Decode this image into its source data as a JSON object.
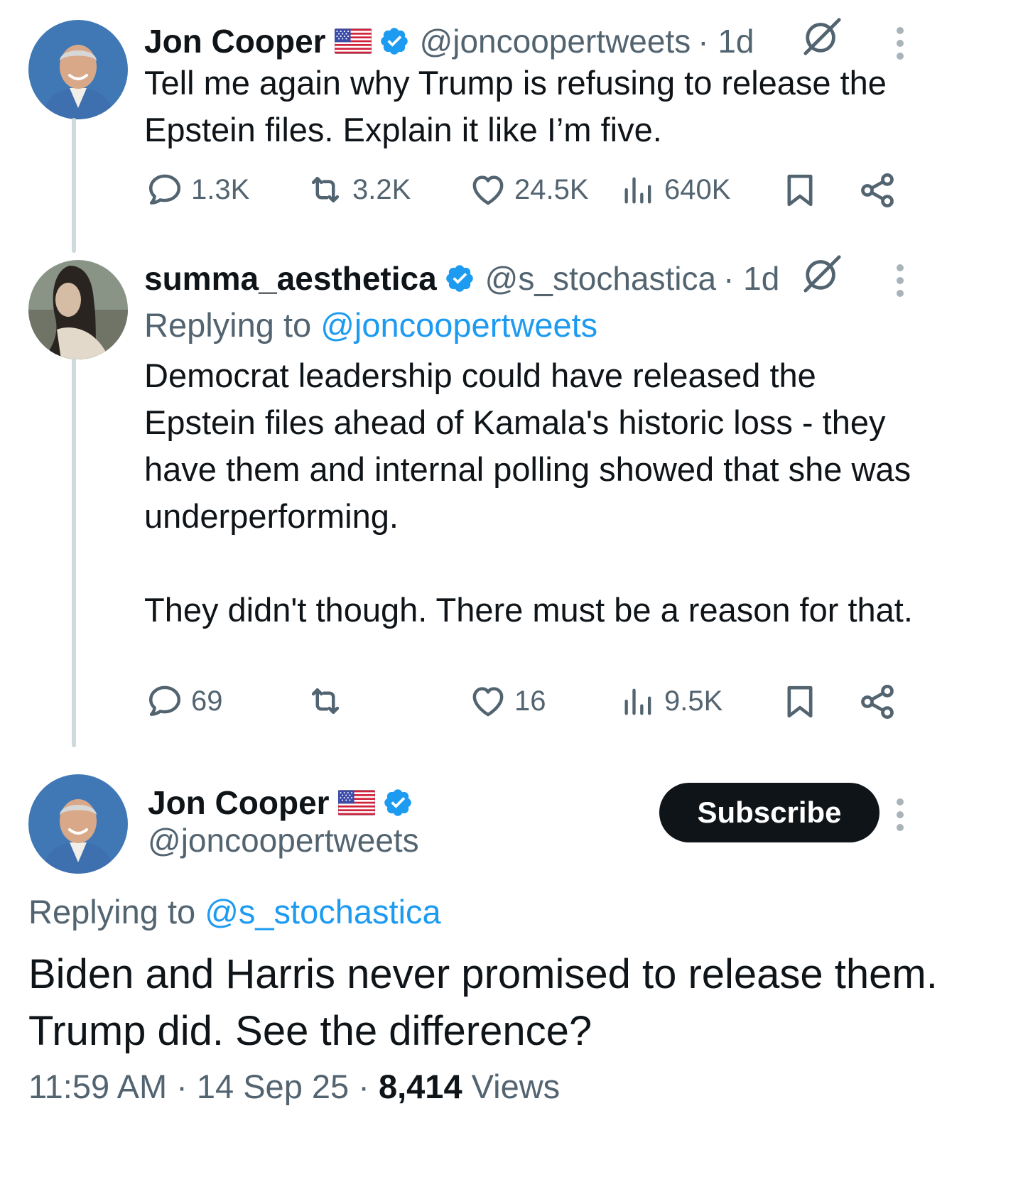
{
  "colors": {
    "text": "#0f1419",
    "muted": "#536471",
    "accent": "#1d9bf0",
    "thread_line": "#cfd9de",
    "button_bg": "#0f1419"
  },
  "tweets": [
    {
      "name": "Jon Cooper",
      "handle": "@joncoopertweets",
      "time": "· 1d",
      "badges": [
        "us-flag-icon",
        "verified-icon"
      ],
      "text": "Tell me again why Trump is refusing to release the Epstein files. Explain it like I’m five.",
      "actions": {
        "replies": "1.3K",
        "reposts": "3.2K",
        "likes": "24.5K",
        "views": "640K"
      }
    },
    {
      "name": "summa_aesthetica",
      "handle": "@s_stochastica",
      "time": "· 1d",
      "badges": [
        "verified-icon"
      ],
      "replying_prefix": "Replying to",
      "replying_to": "@joncoopertweets",
      "text": "Democrat leadership could have released the Epstein files ahead of Kamala's historic loss - they have them and internal polling showed that she was underperforming.\n\nThey didn't though.  There must be a reason for that.",
      "actions": {
        "replies": "69",
        "reposts": "",
        "likes": "16",
        "views": "9.5K"
      }
    }
  ],
  "main_tweet": {
    "name": "Jon Cooper",
    "handle": "@joncoopertweets",
    "badges": [
      "us-flag-icon",
      "verified-icon"
    ],
    "subscribe_label": "Subscribe",
    "replying_prefix": "Replying to",
    "replying_to": "@s_stochastica",
    "text": "Biden and Harris never promised to release them. Trump did. See the difference?",
    "time": "11:59 AM",
    "date": "14 Sep 25",
    "views_count": "8,414",
    "views_label": "Views",
    "separator": "·"
  }
}
